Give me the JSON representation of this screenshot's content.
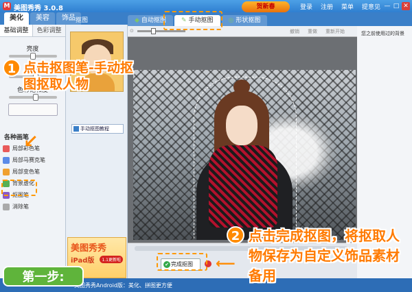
{
  "app": {
    "title": "美图秀秀 3.0.8",
    "icon_letter": "M",
    "menu": [
      "登录",
      "注册",
      "菜单",
      "提意见"
    ],
    "minimize": "—",
    "maximize": "□",
    "close": "✕",
    "deco_badge": "贺新春"
  },
  "main_tabs": [
    {
      "label": "美化",
      "active": true
    },
    {
      "label": "美容",
      "active": false
    },
    {
      "label": "饰品",
      "active": false
    }
  ],
  "left_panel": {
    "sub_tabs": [
      "基础调整",
      "色彩调整"
    ],
    "sliders": [
      {
        "label": "亮度",
        "level": 0.45
      },
      {
        "label": "对比度",
        "level": 0.5
      },
      {
        "label": "色彩饱和度",
        "level": 0.5
      }
    ],
    "brush_header": "各种画笔",
    "brushes": [
      {
        "label": "局部彩色笔",
        "icon": "palette-icon",
        "color": "#e85a5a"
      },
      {
        "label": "局部马赛克笔",
        "icon": "mosaic-icon",
        "color": "#5a8ae8"
      },
      {
        "label": "局部变色笔",
        "icon": "color-icon",
        "color": "#f0a030"
      },
      {
        "label": "背景虚化",
        "icon": "blur-icon",
        "color": "#55b055"
      },
      {
        "label": "抠图笔",
        "icon": "cutout-pen-icon",
        "color": "#8a5ac8"
      },
      {
        "label": "消除笔",
        "icon": "eraser-icon",
        "color": "#aaaaaa"
      }
    ]
  },
  "mid_panel": {
    "tutorial_label": "手动抠图教程",
    "ad_title": "美图秀秀",
    "ad_sub": "iPad版",
    "ad_badge": "1.1更新啦"
  },
  "editor": {
    "header": "抠图",
    "tabs": [
      {
        "label": "自动抠图",
        "active": false
      },
      {
        "label": "手动抠图",
        "active": true
      },
      {
        "label": "形状抠图",
        "active": false
      }
    ],
    "toolbar": {
      "undo": "撤销",
      "redo": "重做",
      "reset": "重新开始"
    },
    "finish_label": "完成抠图"
  },
  "right_panel": {
    "recent_label": "您之前使用过的背景"
  },
  "statusbar": {
    "text": "美图秀秀Android版：美化、拼图更方便"
  },
  "annotations": {
    "step1_num": "1",
    "step1_text": "点击抠图笔-手动抠图抠取人物",
    "step2_num": "2",
    "step2_text": "点击完成抠图，将抠取人物保存为自定义饰品素材备用",
    "step_badge": "第一步:"
  }
}
